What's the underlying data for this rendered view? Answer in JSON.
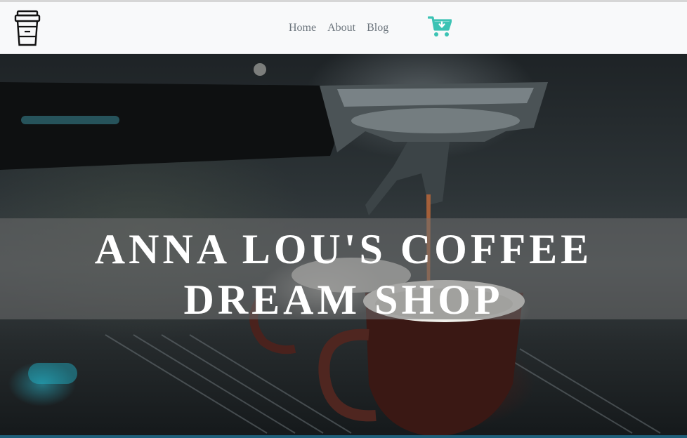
{
  "brand": {
    "logo_icon": "coffee-cup-icon"
  },
  "nav": {
    "items": [
      {
        "label": "Home"
      },
      {
        "label": "About"
      },
      {
        "label": "Blog"
      }
    ],
    "cart_icon": "cart-download-icon"
  },
  "hero": {
    "title": "ANNA LOU'S COFFEE DREAM SHOP",
    "image": "espresso-machine-pouring-coffee"
  },
  "colors": {
    "accent": "#3cc3b4",
    "nav_text": "#6c757d",
    "navbar_bg": "#f8f9fa"
  }
}
